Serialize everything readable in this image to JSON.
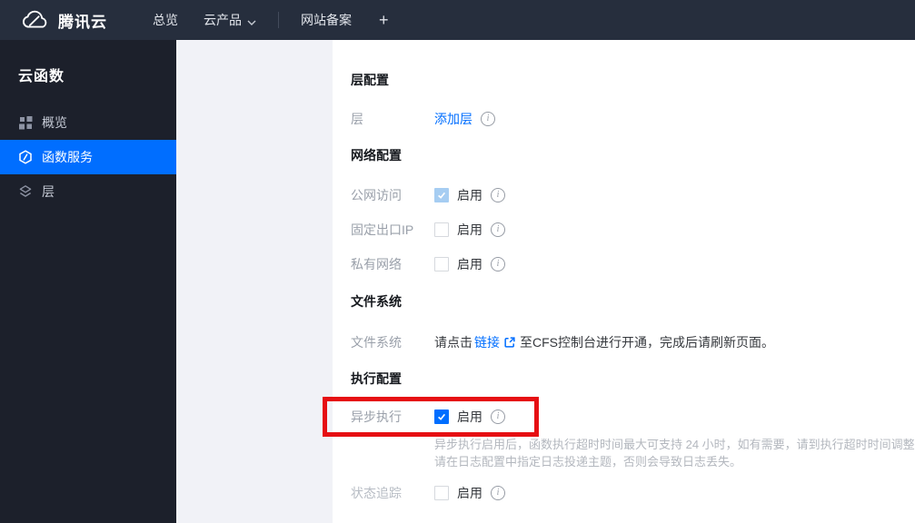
{
  "navbar": {
    "brand": "腾讯云",
    "menu": [
      {
        "label": "总览"
      },
      {
        "label": "云产品",
        "chevron": "chevron-down-icon"
      },
      {
        "label": "网站备案"
      },
      {
        "label": "+"
      }
    ]
  },
  "sidebar": {
    "title": "云函数",
    "items": [
      {
        "label": "概览",
        "icon": "overview-grid-icon",
        "active": false
      },
      {
        "label": "函数服务",
        "icon": "function-service-icon",
        "active": true
      },
      {
        "label": "层",
        "icon": "layers-icon",
        "active": false
      }
    ]
  },
  "main": {
    "sections": {
      "layer_config": {
        "title": "层配置"
      },
      "network_config": {
        "title": "网络配置"
      },
      "file_system": {
        "title": "文件系统"
      },
      "execution_config": {
        "title": "执行配置"
      }
    },
    "rows": {
      "layer": {
        "label": "层",
        "link": "添加层",
        "info": true
      },
      "public_access": {
        "label": "公网访问",
        "checkbox_label": "启用",
        "checked": true,
        "disabled": true,
        "info": true
      },
      "fixed_egress_ip": {
        "label": "固定出口IP",
        "checkbox_label": "启用",
        "checked": false,
        "info": true
      },
      "private_network": {
        "label": "私有网络",
        "checkbox_label": "启用",
        "checked": false,
        "info": true
      },
      "file_system": {
        "label": "文件系统",
        "text_before": "请点击",
        "link": "链接",
        "link_icon": "external-link-icon",
        "text_after": "至CFS控制台进行开通，完成后请刷新页面。"
      },
      "async_execution": {
        "label": "异步执行",
        "checkbox_label": "启用",
        "checked": true,
        "info": true,
        "helper_line1": "异步执行启用后，函数执行超时时间最大可支持 24 小时，如有需要，请到执行超时时间调整。",
        "helper_line2": "请在日志配置中指定日志投递主题，否则会导致日志丢失。"
      },
      "status_tracking": {
        "label": "状态追踪",
        "checkbox_label": "启用",
        "checked": false,
        "info": true
      }
    }
  },
  "annotation": {
    "shape": "red-highlight-rectangle",
    "color": "#e60f13",
    "target": "async_execution_row"
  },
  "icons": {
    "info_glyph": "i"
  },
  "colors": {
    "accent_blue": "#006eff",
    "navbar_bg": "#262e3d",
    "sidebar_bg": "#1c202b",
    "gutter_bg": "#f1f2f7",
    "disabled_checked_blue": "#a6cdf2",
    "annotation_red": "#e60f13"
  }
}
